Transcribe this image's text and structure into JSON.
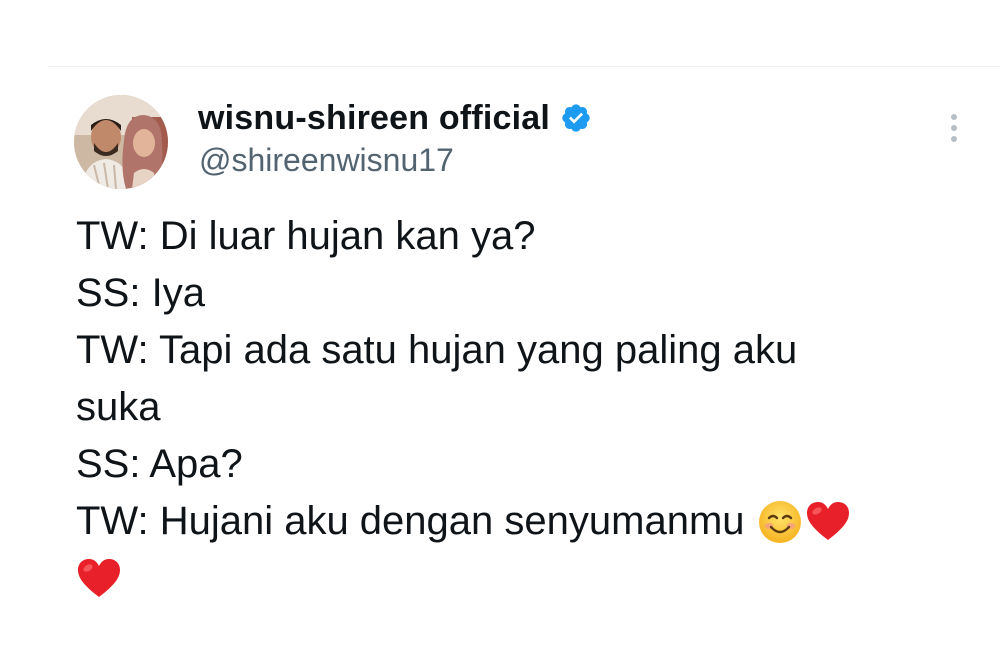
{
  "tweet": {
    "display_name": "wisnu-shireen official",
    "handle": "@shireenwisnu17",
    "verified": true,
    "accent_color": "#1d9bf0",
    "icons": {
      "verified": "verified-badge-icon",
      "more": "more-vertical-icon",
      "smile": "smiling-face-emoji",
      "heart": "red-heart-emoji"
    },
    "body_lines": [
      "TW: Di luar hujan kan ya?",
      "SS: Iya",
      "TW: Tapi ada satu hujan yang paling aku",
      "suka",
      "SS: Apa?",
      "TW: Hujani aku dengan senyumanmu"
    ]
  }
}
